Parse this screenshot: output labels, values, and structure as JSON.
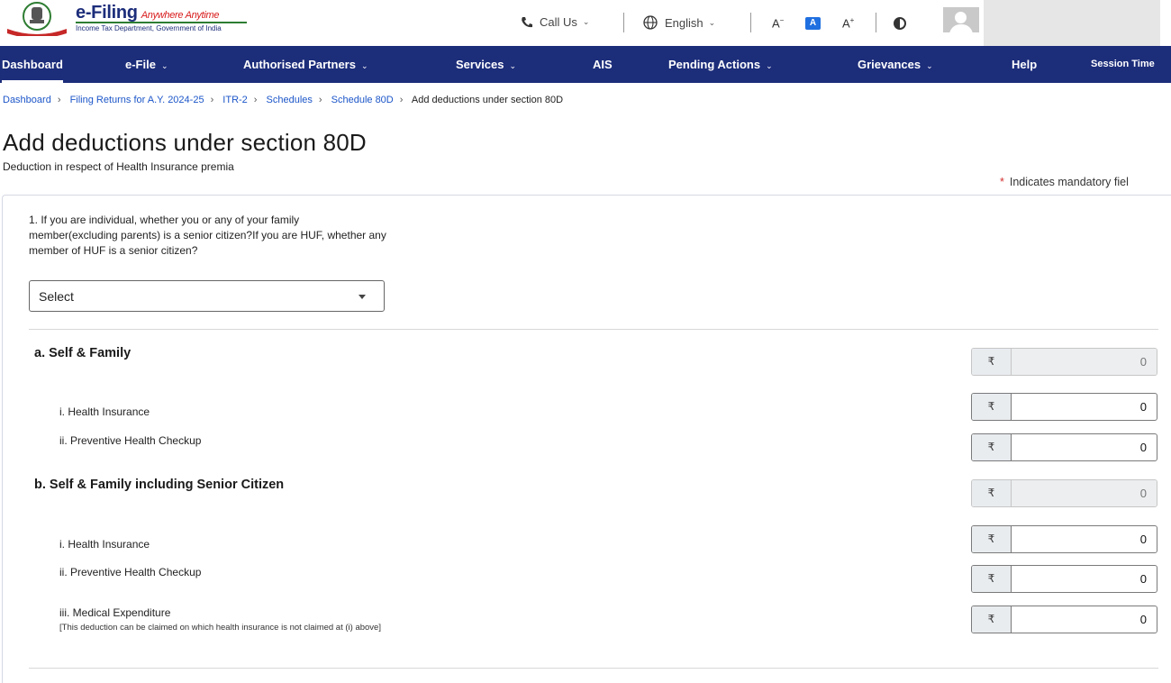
{
  "header": {
    "brand": "e-Filing",
    "tagline": "Anywhere Anytime",
    "subtitle": "Income Tax Department, Government of India",
    "call_us": "Call Us",
    "language": "English",
    "font_decrease": "A",
    "font_normal": "A",
    "font_increase": "A",
    "icons": [
      "emblem-logo",
      "phone-icon",
      "globe-icon",
      "contrast-icon",
      "avatar-icon"
    ]
  },
  "nav": {
    "items": [
      {
        "label": "Dashboard",
        "dropdown": false,
        "active": true
      },
      {
        "label": "e-File",
        "dropdown": true
      },
      {
        "label": "Authorised Partners",
        "dropdown": true
      },
      {
        "label": "Services",
        "dropdown": true
      },
      {
        "label": "AIS",
        "dropdown": false
      },
      {
        "label": "Pending Actions",
        "dropdown": true
      },
      {
        "label": "Grievances",
        "dropdown": true
      },
      {
        "label": "Help",
        "dropdown": false
      },
      {
        "label": "Session Time",
        "dropdown": false
      }
    ]
  },
  "breadcrumb": {
    "items": [
      "Dashboard",
      "Filing Returns for A.Y. 2024-25",
      "ITR-2",
      "Schedules",
      "Schedule 80D"
    ],
    "current": "Add deductions under section 80D"
  },
  "page": {
    "title": "Add deductions under section 80D",
    "subtitle": "Deduction in respect of Health Insurance premia",
    "mandatory_note": "Indicates mandatory fiel"
  },
  "question1": {
    "text": "1. If you are individual, whether you or any of your family member(excluding parents) is a senior citizen?If you are HUF, whether any member of HUF is a senior citizen?",
    "select_value": "Select"
  },
  "currency_symbol": "₹",
  "section_a": {
    "title": "a. Self & Family",
    "total": "0",
    "rows": [
      {
        "label": "i. Health Insurance",
        "value": "0"
      },
      {
        "label": "ii. Preventive Health Checkup",
        "value": "0"
      }
    ]
  },
  "section_b": {
    "title": "b. Self & Family including Senior Citizen",
    "total": "0",
    "rows": [
      {
        "label": "i. Health Insurance",
        "value": "0"
      },
      {
        "label": "ii. Preventive Health Checkup",
        "value": "0"
      },
      {
        "label": "iii. Medical Expenditure",
        "value": "0",
        "note": "[This deduction can be claimed on which health insurance is not claimed at (i) above]"
      }
    ]
  },
  "colors": {
    "nav_bg": "#1c2d7a",
    "link": "#1c56c9",
    "mandatory_star": "#d32f2f",
    "font_toggle_active": "#1f6fe0"
  }
}
